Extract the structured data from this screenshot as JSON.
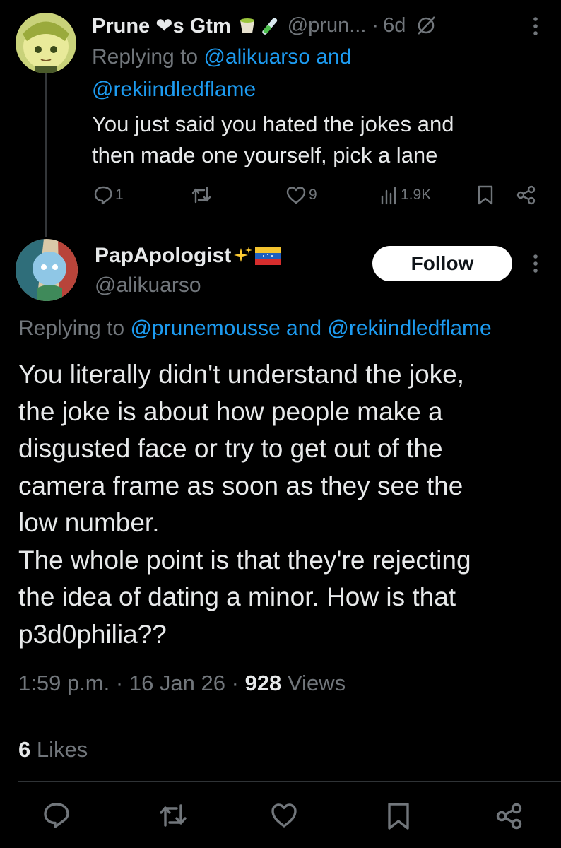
{
  "reply": {
    "display_name": "Prune ❤s Gtm",
    "name_emojis": [
      "matcha-cup-emoji",
      "test-tube-emoji"
    ],
    "handle": "@prun...",
    "separator": "·",
    "time": "6d",
    "replying_prefix": "Replying to",
    "replying_user1": "@alikuarso",
    "replying_and": "and",
    "replying_user2": "@rekiindledflame",
    "text_line1": "You just said you hated the jokes and",
    "text_line2": "then made one yourself, pick a lane",
    "reply_count": "1",
    "like_count": "9",
    "view_count": "1.9K"
  },
  "tweet": {
    "display_name": "PapApologist",
    "name_emojis": [
      "sparkles-emoji",
      "venezuela-flag-emoji"
    ],
    "handle": "@alikuarso",
    "follow_label": "Follow",
    "replying_prefix": "Replying to",
    "replying_user1": "@prunemousse",
    "replying_and": "and",
    "replying_user2": "@rekiindledflame",
    "text_lines": [
      "You literally didn't understand the joke,",
      "the joke is about how people make a",
      "disgusted face or try to get out of the",
      "camera frame as soon as they see the",
      "low number.",
      "The whole point is that they're rejecting",
      "the idea of dating a minor. How is that",
      "p3d0philia??"
    ],
    "time": "1:59 p.m.",
    "date": "16 Jan 26",
    "separator": "·",
    "views_count": "928",
    "views_label": "Views",
    "likes_count": "6",
    "likes_label": "Likes"
  },
  "colors": {
    "background": "#000000",
    "text": "#e7e9ea",
    "muted": "#71767b",
    "link": "#1d9bf0",
    "divider": "#2f3336"
  }
}
